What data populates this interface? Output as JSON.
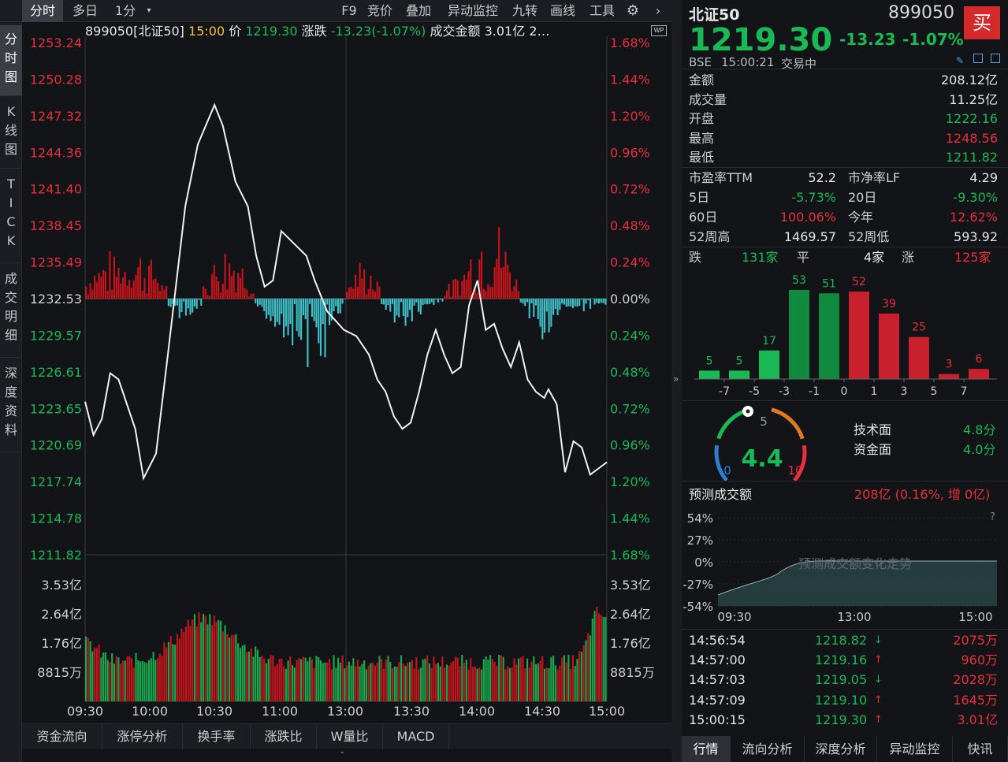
{
  "toolbar": {
    "tabs": [
      "分时",
      "多日",
      "1分",
      "F9",
      "竞价",
      "叠加",
      "异动监控",
      "九转",
      "画线",
      "工具"
    ],
    "dropdown_icon": "caret-down-icon",
    "settings_icon": "gear-icon",
    "next_icon": "chevron-right-icon"
  },
  "left_tabs": [
    "分时图",
    "K线图",
    "TICK",
    "成交明细",
    "深度资料"
  ],
  "chart_header": {
    "code_name": "899050[北证50]",
    "time": "15:00",
    "price_label": "价",
    "price": "1219.30",
    "change_label": "涨跌",
    "change": "-13.23(-1.07%)",
    "amount_label": "成交金额",
    "amount": "3.01亿",
    "more": "2…",
    "wp_badge": "WP"
  },
  "chart_data": {
    "type": "line",
    "title": "899050[北证50]",
    "prev_close": 1232.53,
    "ylim": [
      1211.82,
      1253.24
    ],
    "price_ticks": [
      "1253.24",
      "1250.28",
      "1247.32",
      "1244.36",
      "1241.40",
      "1238.45",
      "1235.49",
      "1232.53",
      "1229.57",
      "1226.61",
      "1223.65",
      "1220.69",
      "1217.74",
      "1214.78",
      "1211.82"
    ],
    "pct_ticks": [
      "1.68%",
      "1.44%",
      "1.20%",
      "0.96%",
      "0.72%",
      "0.48%",
      "0.24%",
      "0.00%",
      "0.24%",
      "0.48%",
      "0.72%",
      "0.96%",
      "1.20%",
      "1.44%",
      "1.68%"
    ],
    "vol_ticks": [
      "3.53亿",
      "2.64亿",
      "1.76亿",
      "8815万"
    ],
    "time_ticks": [
      "09:30",
      "10:00",
      "10:30",
      "11:00",
      "13:00",
      "13:30",
      "14:00",
      "14:30",
      "15:00"
    ],
    "price_keypoints": [
      [
        0,
        1224.2
      ],
      [
        2,
        1221.5
      ],
      [
        4,
        1222.8
      ],
      [
        6,
        1226.5
      ],
      [
        8,
        1226.0
      ],
      [
        12,
        1222.0
      ],
      [
        14,
        1218.0
      ],
      [
        17,
        1220.0
      ],
      [
        20,
        1228.5
      ],
      [
        24,
        1240.0
      ],
      [
        27,
        1245.0
      ],
      [
        31,
        1248.2
      ],
      [
        33,
        1246.5
      ],
      [
        36,
        1242.0
      ],
      [
        39,
        1240.0
      ],
      [
        41,
        1236.0
      ],
      [
        43,
        1233.5
      ],
      [
        45,
        1234.0
      ],
      [
        47,
        1238.0
      ],
      [
        50,
        1237.0
      ],
      [
        53,
        1236.0
      ],
      [
        55,
        1234.0
      ],
      [
        58,
        1231.5
      ],
      [
        62,
        1230.0
      ],
      [
        65,
        1229.5
      ],
      [
        68,
        1228.0
      ],
      [
        70,
        1226.0
      ],
      [
        72,
        1225.0
      ],
      [
        74,
        1223.0
      ],
      [
        76,
        1222.0
      ],
      [
        78,
        1222.5
      ],
      [
        80,
        1225.0
      ],
      [
        82,
        1228.0
      ],
      [
        84,
        1230.0
      ],
      [
        86,
        1228.0
      ],
      [
        88,
        1226.5
      ],
      [
        90,
        1227.0
      ],
      [
        92,
        1232.0
      ],
      [
        94,
        1234.0
      ],
      [
        96,
        1230.0
      ],
      [
        98,
        1230.5
      ],
      [
        100,
        1228.5
      ],
      [
        102,
        1227.0
      ],
      [
        104,
        1229.0
      ],
      [
        106,
        1226.0
      ],
      [
        108,
        1225.0
      ],
      [
        110,
        1224.5
      ],
      [
        111,
        1225.2
      ],
      [
        113,
        1224.0
      ],
      [
        115,
        1218.5
      ],
      [
        117,
        1221.0
      ],
      [
        119,
        1220.5
      ],
      [
        121,
        1218.3
      ],
      [
        123,
        1218.8
      ],
      [
        125,
        1219.3
      ]
    ],
    "diff_bars": {
      "note": "red above 0 / cyan below 0, relative strength"
    },
    "series": [
      {
        "name": "价",
        "color": "#ffffff"
      }
    ]
  },
  "bottom_tabs": [
    "资金流向",
    "涨停分析",
    "换手率",
    "涨跌比",
    "W量比",
    "MACD"
  ],
  "right": {
    "name": "北证50",
    "code": "899050",
    "buy": "买",
    "price": "1219.30",
    "change": "-13.23",
    "change_pct": "-1.07%",
    "exchange": "BSE",
    "time": "15:00:21",
    "status": "交易中",
    "stats": [
      {
        "l": "金额",
        "v": "208.12亿",
        "c": "white"
      },
      {
        "l": "成交量",
        "v": "11.25亿",
        "c": "white"
      },
      {
        "l": "开盘",
        "v": "1222.16",
        "c": "green"
      },
      {
        "l": "最高",
        "v": "1248.56",
        "c": "red"
      },
      {
        "l": "最低",
        "v": "1211.82",
        "c": "green"
      }
    ],
    "stats2": [
      [
        {
          "l": "市盈率TTM",
          "v": "52.2",
          "c": "white"
        },
        {
          "l": "市净率LF",
          "v": "4.29",
          "c": "white"
        }
      ],
      [
        {
          "l": "5日",
          "v": "-5.73%",
          "c": "green"
        },
        {
          "l": "20日",
          "v": "-9.30%",
          "c": "green"
        }
      ],
      [
        {
          "l": "60日",
          "v": "100.06%",
          "c": "red"
        },
        {
          "l": "今年",
          "v": "12.62%",
          "c": "red"
        }
      ],
      [
        {
          "l": "52周高",
          "v": "1469.57",
          "c": "white"
        },
        {
          "l": "52周低",
          "v": "593.92",
          "c": "white"
        }
      ]
    ],
    "breadth": {
      "down_label": "跌",
      "down": "131家",
      "flat_label": "平",
      "flat": "4家",
      "up_label": "涨",
      "up": "125家"
    },
    "dist": {
      "values": [
        5,
        5,
        17,
        53,
        51,
        52,
        39,
        25,
        3,
        6
      ],
      "labels": [
        "-7",
        "-5",
        "-3",
        "-1",
        "0",
        "1",
        "3",
        "5",
        "7"
      ],
      "colors": [
        "#19b955",
        "#19b955",
        "#19b955",
        "#0f8a3e",
        "#0f8a3e",
        "#c8202c",
        "#c8202c",
        "#c8202c",
        "#c8202c",
        "#c8202c"
      ]
    },
    "gauge": {
      "score": "4.4",
      "min": "0",
      "mid": "5",
      "max": "10",
      "tech_label": "技术面",
      "tech": "4.8分",
      "fund_label": "资金面",
      "fund": "4.0分"
    },
    "forecast": {
      "label": "预测成交额",
      "value": "208亿 (0.16%, 增 0亿)",
      "help": "?",
      "yticks": [
        "54%",
        "27%",
        "0%",
        "-27%",
        "-54%"
      ],
      "xticks": [
        "09:30",
        "13:00",
        "15:00"
      ],
      "caption": "预测成交额变化走势"
    },
    "ticks": [
      {
        "t": "14:56:54",
        "p": "1218.82",
        "d": "↓",
        "pc": "green",
        "v": "2075万"
      },
      {
        "t": "14:57:00",
        "p": "1219.16",
        "d": "↑",
        "pc": "green",
        "v": "960万"
      },
      {
        "t": "14:57:03",
        "p": "1219.05",
        "d": "↓",
        "pc": "green",
        "v": "2028万"
      },
      {
        "t": "14:57:09",
        "p": "1219.10",
        "d": "↑",
        "pc": "green",
        "v": "1645万"
      },
      {
        "t": "15:00:15",
        "p": "1219.30",
        "d": "↑",
        "pc": "green",
        "v": "3.01亿"
      }
    ],
    "tabs": [
      "行情",
      "流向分析",
      "深度分析",
      "异动监控",
      "快讯"
    ]
  }
}
